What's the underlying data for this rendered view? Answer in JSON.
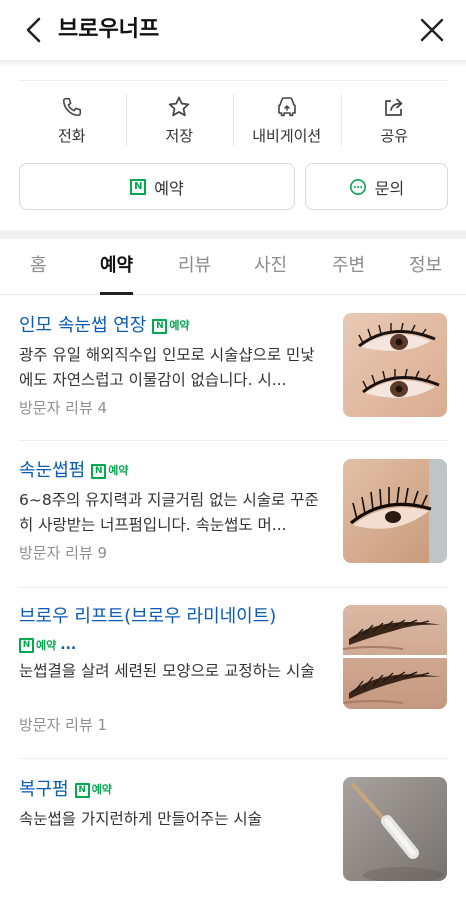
{
  "header": {
    "title": "브로우너프"
  },
  "actions": [
    {
      "label": "전화",
      "icon": "phone-icon"
    },
    {
      "label": "저장",
      "icon": "star-icon"
    },
    {
      "label": "내비게이션",
      "icon": "navigation-car-icon"
    },
    {
      "label": "공유",
      "icon": "share-icon"
    }
  ],
  "buttons": {
    "reserve": "예약",
    "inquiry": "문의"
  },
  "tabs": [
    {
      "label": "홈"
    },
    {
      "label": "예약",
      "active": true
    },
    {
      "label": "리뷰"
    },
    {
      "label": "사진"
    },
    {
      "label": "주변"
    },
    {
      "label": "정보"
    }
  ],
  "badge": {
    "n": "N",
    "label": "예약",
    "ellipsis": "..."
  },
  "items": [
    {
      "title": "인모 속눈썹 연장",
      "desc": "광주 유일 해외직수입 인모로 시술샵으로 민낯에도 자연스럽고 이물감이 없습니다. 시...",
      "meta": "방문자 리뷰 4",
      "thumb": "eyelash-extension-photo"
    },
    {
      "title": "속눈썹펌",
      "desc": "6~8주의 유지력과 지글거림 없는 시술로 꾸준히 사랑받는 너프펌입니다. 속눈썹도 머...",
      "meta": "방문자 리뷰 9",
      "thumb": "eyelash-perm-photo"
    },
    {
      "title": "브로우 리프트(브로우 라미네이트)",
      "desc": "눈썹결을 살려 세련된 모양으로 교정하는 시술",
      "meta": "방문자 리뷰 1",
      "thumb": "brow-lift-photo"
    },
    {
      "title": "복구펌",
      "desc": "속눈썹을 가지런하게 만들어주는 시술",
      "meta": "",
      "thumb": "lash-brush-photo"
    }
  ],
  "colors": {
    "accent_green": "#03a94d",
    "link_blue": "#0b5bb7",
    "tab_active": "#111111",
    "tab_inactive": "#8c8c8c"
  }
}
